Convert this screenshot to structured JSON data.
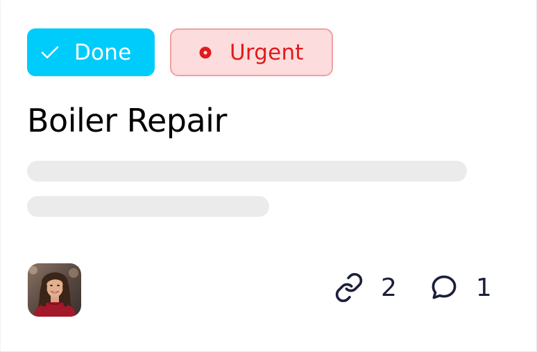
{
  "card": {
    "tags": [
      {
        "label": "Done",
        "icon": "check-icon",
        "bg": "#00ccfc",
        "color": "#ffffff"
      },
      {
        "label": "Urgent",
        "icon": "dot-icon",
        "bg": "#fcdcdc",
        "border": "#f0a0a0",
        "color": "#e01b1b"
      }
    ],
    "title": "Boiler Repair",
    "attachments_count": "2",
    "comments_count": "1",
    "avatar_icon": "user-avatar-photo"
  }
}
